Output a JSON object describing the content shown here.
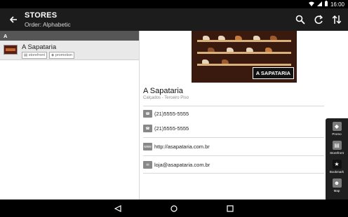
{
  "status_bar": {
    "time": "16:00"
  },
  "header": {
    "title": "STORES",
    "subtitle": "Order: Alphabetic"
  },
  "list": {
    "section_letter": "A",
    "items": [
      {
        "name": "A Sapataria",
        "tags": [
          "storefront",
          "promotion"
        ]
      }
    ]
  },
  "detail": {
    "logo_text": "A SAPATARIA",
    "name": "A Sapataria",
    "category": "Calçados - Terceiro Piso",
    "phones": [
      "(21)5555-5555",
      "(21)5555-5555"
    ],
    "website": "http://asapataria.com.br",
    "email": "loja@asapataria.com.br"
  },
  "actions": [
    {
      "label": "Promo",
      "icon": "tag-icon"
    },
    {
      "label": "Storefront",
      "icon": "storefront-icon"
    },
    {
      "label": "Bookmark",
      "icon": "star-icon"
    },
    {
      "label": "Map",
      "icon": "map-icon"
    }
  ]
}
